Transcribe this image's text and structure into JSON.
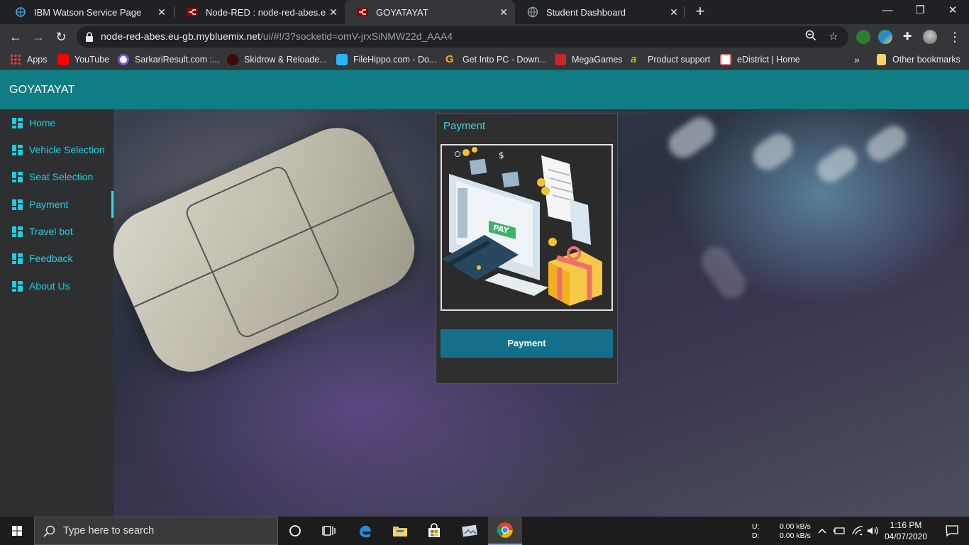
{
  "browser": {
    "tabs": [
      {
        "title": "IBM Watson Service Page",
        "active": false
      },
      {
        "title": "Node-RED : node-red-abes.eu-gb",
        "active": false
      },
      {
        "title": "GOYATAYAT",
        "active": true
      },
      {
        "title": "Student Dashboard",
        "active": false
      }
    ],
    "address": {
      "host": "node-red-abes.eu-gb.mybluemix.net",
      "path": "/ui/#!/3?socketid=omV-jrxSiNMW22d_AAA4"
    },
    "bookmarks": [
      {
        "label": "Apps",
        "icon": "apps-grid-icon",
        "color": "#e8eaed"
      },
      {
        "label": "YouTube",
        "icon": "youtube-icon",
        "color": "#ff0000"
      },
      {
        "label": "SarkariResult.com :...",
        "icon": "sarkari-icon",
        "color": "#7e57c2"
      },
      {
        "label": "Skidrow & Reloade...",
        "icon": "skidrow-icon",
        "color": "#b71c1c"
      },
      {
        "label": "FileHippo.com - Do...",
        "icon": "filehippo-icon",
        "color": "#29b6f6"
      },
      {
        "label": "Get Into PC - Down...",
        "icon": "getintopc-icon",
        "color": "#f9a825"
      },
      {
        "label": "MegaGames",
        "icon": "megagames-icon",
        "color": "#c62828"
      },
      {
        "label": "Product support",
        "icon": "product-support-icon",
        "color": "#9ccc00"
      },
      {
        "label": "eDistrict | Home",
        "icon": "edistrict-icon",
        "color": "#e57373"
      }
    ],
    "other_bookmarks": "Other bookmarks",
    "overflow": "»"
  },
  "app": {
    "title": "GOYATAYAT",
    "accent": "#0f7d83",
    "nav": [
      {
        "label": "Home",
        "active": false
      },
      {
        "label": "Vehicle Selection",
        "active": false
      },
      {
        "label": "Seat Selection",
        "active": false
      },
      {
        "label": "Payment",
        "active": true
      },
      {
        "label": "Travel bot",
        "active": false
      },
      {
        "label": "Feedback",
        "active": false
      },
      {
        "label": "About Us",
        "active": false
      }
    ],
    "payment_card": {
      "title": "Payment",
      "image_text": "PAY",
      "button_label": "Payment"
    }
  },
  "taskbar": {
    "search_placeholder": "Type here to search",
    "net_upload_label": "U:",
    "net_download_label": "D:",
    "net_upload": "0.00 kB/s",
    "net_download": "0.00 kB/s",
    "time": "1:16 PM",
    "date": "04/07/2020"
  }
}
